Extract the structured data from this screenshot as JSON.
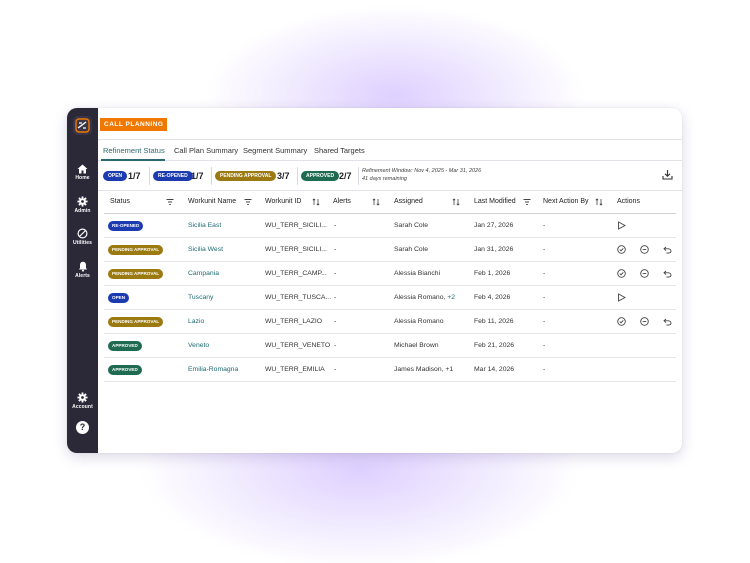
{
  "app_badge": "CALL PLANNING",
  "sidebar": {
    "items": [
      {
        "label": "Home",
        "icon": "home-icon"
      },
      {
        "label": "Admin",
        "icon": "gear-icon"
      },
      {
        "label": "Utilities",
        "icon": "utilities-icon"
      },
      {
        "label": "Alerts",
        "icon": "bell-icon"
      },
      {
        "label": "Account",
        "icon": "gear-icon"
      }
    ],
    "help": "?"
  },
  "tabs": [
    "Refinement Status",
    "Call Plan Summary",
    "Segment Summary",
    "Shared Targets"
  ],
  "summary": {
    "open": {
      "label": "OPEN",
      "count": "1/7"
    },
    "reopened": {
      "label": "RE-OPENED",
      "count": "1/7"
    },
    "pending": {
      "label": "PENDING APPROVAL",
      "count": "3/7"
    },
    "approved": {
      "label": "APPROVED",
      "count": "2/7"
    },
    "window": "Refinement Window: Nov 4, 2025 - Mar 31, 2026",
    "remaining": "41 days remaining"
  },
  "columns": [
    "Status",
    "Workunit Name",
    "Workunit ID",
    "Alerts",
    "Assigned",
    "Last Modified",
    "Next Action By",
    "Actions"
  ],
  "rows": [
    {
      "status": "RE-OPENED",
      "name": "Sicilia East",
      "id": "WU_TERR_SICILI...",
      "alerts": "-",
      "assigned": "Sarah Cole",
      "assigned_extra": "",
      "modified": "Jan 27, 2026",
      "next": "-"
    },
    {
      "status": "PENDING APPROVAL",
      "name": "Sicilia West",
      "id": "WU_TERR_SICILI...",
      "alerts": "-",
      "assigned": "Sarah Cole",
      "assigned_extra": "",
      "modified": "Jan 31, 2026",
      "next": "-"
    },
    {
      "status": "PENDING APPROVAL",
      "name": "Campania",
      "id": "WU_TERR_CAMP...",
      "alerts": "-",
      "assigned": "Alessia Bianchi",
      "assigned_extra": "",
      "modified": "Feb 1, 2026",
      "next": "-"
    },
    {
      "status": "OPEN",
      "name": "Tuscany",
      "id": "WU_TERR_TUSCA...",
      "alerts": "-",
      "assigned": "Alessia Romano,",
      "assigned_extra": "+2",
      "modified": "Feb 4, 2026",
      "next": "-"
    },
    {
      "status": "PENDING APPROVAL",
      "name": "Lazio",
      "id": "WU_TERR_LAZIO",
      "alerts": "-",
      "assigned": "Alessia Romano",
      "assigned_extra": "",
      "modified": "Feb 11, 2026",
      "next": "-"
    },
    {
      "status": "APPROVED",
      "name": "Veneto",
      "id": "WU_TERR_VENETO",
      "alerts": "-",
      "assigned": "Michael Brown",
      "assigned_extra": "",
      "modified": "Feb 21, 2026",
      "next": "-"
    },
    {
      "status": "APPROVED",
      "name": "Emilia-Romagna",
      "id": "WU_TERR_EMILIA",
      "alerts": "-",
      "assigned": "James Madison, +1",
      "assigned_extra": "",
      "modified": "Mar 14, 2026",
      "next": "-"
    }
  ],
  "colors": {
    "sidebar": "#2b2838",
    "accent": "#f07800",
    "link": "#1e6a72",
    "open": "#1d3bb0",
    "reopened": "#1d3bb0",
    "pending": "#9b7a12",
    "approved": "#1f6b52"
  }
}
